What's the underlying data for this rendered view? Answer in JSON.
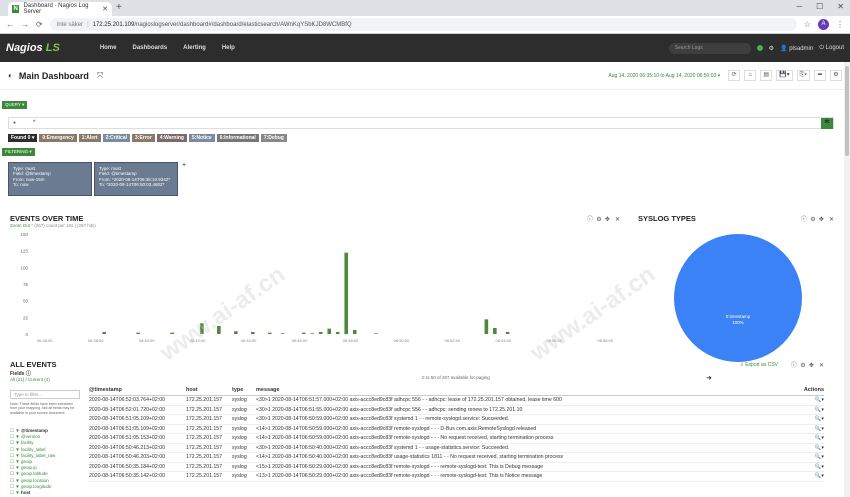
{
  "browser": {
    "tab_title": "Dashboard · Nagios Log Server",
    "favicon": "N",
    "url_secure_label": "Inte säker",
    "url_host": "172.25.201.109",
    "url_path": "/nagioslogserver/dashboard#/dashboard/elasticsearch/AWnKqYSbKJD8WCMBfQ",
    "avatar": "A"
  },
  "nav": {
    "logo_main": "Nagios",
    "logo_suffix": " LS",
    "links": [
      "Home",
      "Dashboards",
      "Alerting",
      "Help"
    ],
    "search_placeholder": "Search Logs",
    "user": "plsadmin",
    "logout": "Logout"
  },
  "page": {
    "title": "Main Dashboard",
    "daterange": "Aug 14, 2020 06:35:10 to Aug 14, 2020 06:50:03 ▾"
  },
  "query": {
    "label": "QUERY ▾",
    "value": "*",
    "levels": [
      {
        "label": "Found 0 ▾",
        "color": "#2d2d2d"
      },
      {
        "label": "0:Emergency",
        "color": "#a33"
      },
      {
        "label": "1:Alert",
        "color": "#c77a1e"
      },
      {
        "label": "2:Critical",
        "color": "#3b78b8"
      },
      {
        "label": "3:Error",
        "color": "#b88a3a"
      },
      {
        "label": "4:Warning",
        "color": "#aa4444"
      },
      {
        "label": "5:Notice",
        "color": "#4f87d1"
      },
      {
        "label": "6:Informational",
        "color": "#666"
      },
      {
        "label": "7:Debug",
        "color": "#777"
      }
    ]
  },
  "filters": {
    "label": "FILTERING ▾",
    "cards": [
      {
        "line1": "Type: must",
        "line2": "Field: @timestamp",
        "line3": "From: now-15m",
        "line4": "To: now"
      },
      {
        "line1": "Type: must",
        "line2": "Field: @timestamp",
        "line3": "From: *2020-08-14T06:35:10.934Z*",
        "line4": "To: *2020-08-14T06:50:03.460Z*"
      }
    ]
  },
  "events_over_time": {
    "title": "EVENTS OVER TIME",
    "sub_zoom_out": "Zoom Out",
    "sub_count": "* (267)",
    "sub_note": "count per 10s | (267 hits)",
    "chart_data": {
      "type": "bar",
      "ylim": [
        0,
        150
      ],
      "yticks": [
        150,
        125,
        100,
        75,
        50,
        25,
        0
      ],
      "xticks": [
        "06:36:00",
        "06:38:00",
        "06:40:00",
        "06:42:00",
        "06:44:00",
        "06:46:00",
        "06:48:00",
        "06:50:00",
        "06:52:00",
        "06:54:00",
        "06:56:00",
        "06:58:00"
      ],
      "bar_color": "#4a8a3a",
      "values": [
        {
          "x": "06:38:20",
          "y": 3
        },
        {
          "x": "06:39:40",
          "y": 2
        },
        {
          "x": "06:41:00",
          "y": 2
        },
        {
          "x": "06:42:10",
          "y": 16
        },
        {
          "x": "06:42:50",
          "y": 12
        },
        {
          "x": "06:43:30",
          "y": 4
        },
        {
          "x": "06:44:10",
          "y": 3
        },
        {
          "x": "06:44:50",
          "y": 2
        },
        {
          "x": "06:45:20",
          "y": 1
        },
        {
          "x": "06:46:10",
          "y": 2
        },
        {
          "x": "06:46:30",
          "y": 1
        },
        {
          "x": "06:46:50",
          "y": 3
        },
        {
          "x": "06:47:10",
          "y": 8
        },
        {
          "x": "06:47:30",
          "y": 3
        },
        {
          "x": "06:47:50",
          "y": 122
        },
        {
          "x": "06:48:10",
          "y": 6
        },
        {
          "x": "06:49:00",
          "y": 1
        },
        {
          "x": "06:53:20",
          "y": 22
        },
        {
          "x": "06:53:40",
          "y": 9
        },
        {
          "x": "06:54:10",
          "y": 3
        }
      ]
    }
  },
  "syslog_types": {
    "title": "SYSLOG TYPES",
    "chart_data": {
      "type": "pie",
      "slices": [
        {
          "label": "0:timestamp",
          "value": 100,
          "pct": "100%",
          "color": "#3b82f6"
        }
      ]
    }
  },
  "all_events": {
    "title": "ALL EVENTS",
    "export": "Export as CSV",
    "fields_label": "Fields",
    "fields_sub": "All (21) / Current (4)",
    "filter_placeholder": "Type to filter...",
    "note": "Note: These fields have been extracted from your mapping. Not all fields may be available in your source document.",
    "fields": [
      "@timestamp",
      "@version",
      "facility",
      "facility_label",
      "facility_label_raw",
      "geoip",
      "geoip.ip",
      "geoip.latitude",
      "geoip.location",
      "geoip.longitude",
      "host"
    ],
    "paging": "0 to 50 of 267 available for paging",
    "columns": [
      "@timestamp",
      "host",
      "type",
      "message",
      "Actions"
    ],
    "rows": [
      [
        "2020-08-14T06:52:03.764+02:00",
        "172.25.201.157",
        "syslog",
        "<30>1 2020-08-14T06:51:57.000+02:00 axis-accc8ed9c83f adhcpc 556 - - adhcpc: lease of 172.25.201.157 obtained, lease time 600"
      ],
      [
        "2020-08-14T06:52:01.720+02:00",
        "172.25.201.157",
        "syslog",
        "<30>1 2020-08-14T06:51:55.000+02:00 axis-accc8ed9c83f adhcpc 556 - - adhcpc: sending renew to 172.25.201.10"
      ],
      [
        "2020-08-14T06:51:05.109+02:00",
        "172.25.201.157",
        "syslog",
        "<30>1 2020-08-14T06:50:59.000+02:00 axis-accc8ed9c83f systemd 1 - - remote-syslogd.service: Succeeded."
      ],
      [
        "2020-08-14T06:51:05.109+02:00",
        "172.25.201.157",
        "syslog",
        "<14>1 2020-08-14T06:50:59.000+02:00 axis-accc8ed9c83f remote-syslogd - - - D-Bus com.axis.RemoteSyslogd released"
      ],
      [
        "2020-08-14T06:51:05.153+02:00",
        "172.25.201.157",
        "syslog",
        "<14>1 2020-08-14T06:50:59.000+02:00 axis-accc8ed9c83f remote-syslogd - - - No request received, starting termination process"
      ],
      [
        "2020-08-14T06:50:46.213+02:00",
        "172.25.201.157",
        "syslog",
        "<30>1 2020-08-14T06:50:40.000+02:00 axis-accc8ed9c83f systemd 1 - - usage-statistics.service: Succeeded."
      ],
      [
        "2020-08-14T06:50:46.203+02:00",
        "172.25.201.157",
        "syslog",
        "<14>1 2020-08-14T06:50:40.000+02:00 axis-accc8ed9c83f usage-statistics 1811 - - No request received, starting termination process"
      ],
      [
        "2020-08-14T06:50:35.184+02:00",
        "172.25.201.157",
        "syslog",
        "<15>1 2020-08-14T06:50:29.000+02:00 axis-accc8ed9c83f remote-syslogd - - - remote-syslogd-test: This is Debug message"
      ],
      [
        "2020-08-14T06:50:35.142+02:00",
        "172.25.201.157",
        "syslog",
        "<13>1 2020-08-14T06:50:29.000+02:00 axis-accc8ed9c83f remote-syslogd - - - remote-syslogd-test: This is Notice message"
      ]
    ]
  },
  "watermark": "www.ai-af.cn"
}
